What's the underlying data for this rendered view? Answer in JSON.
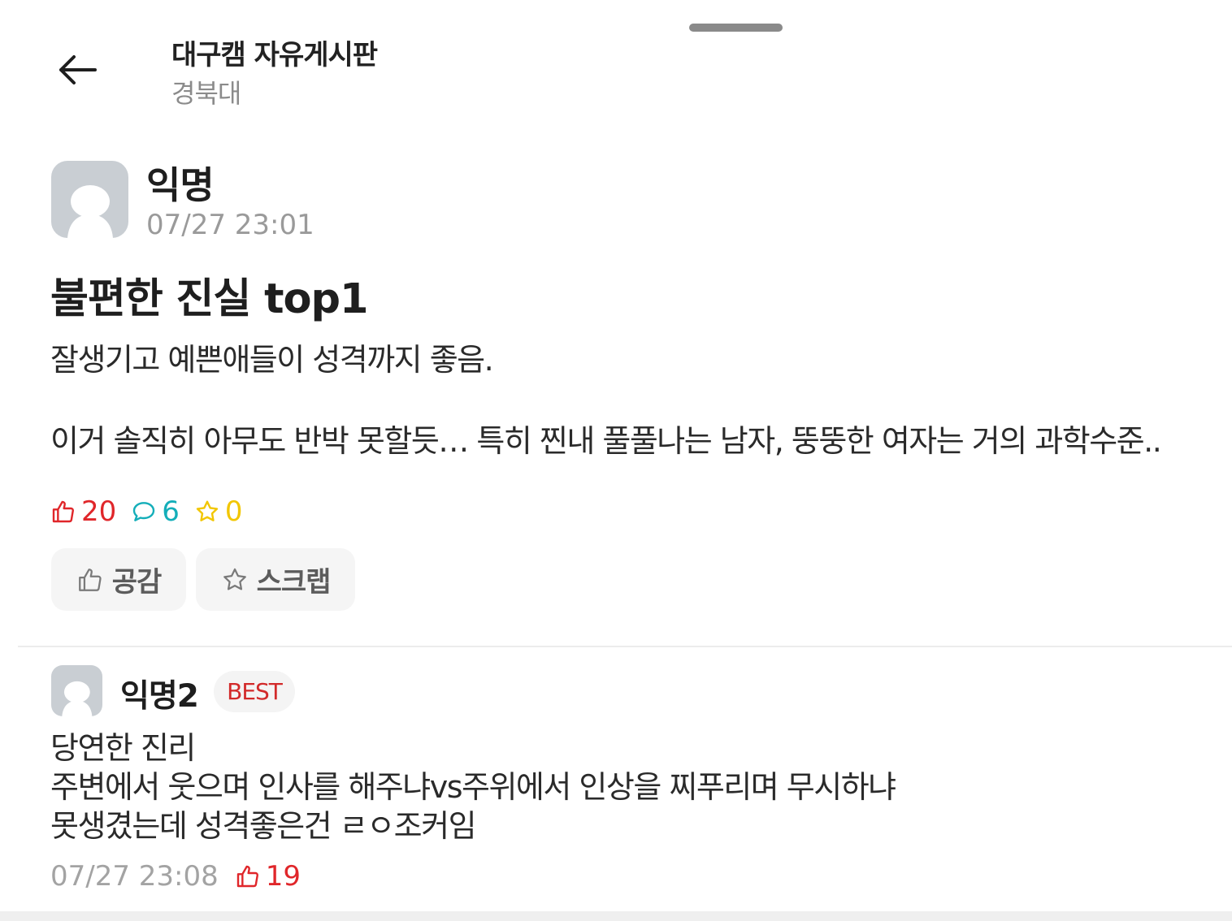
{
  "header": {
    "back_icon": "arrow-left-icon",
    "board_title": "대구캠 자유게시판",
    "board_subtitle": "경북대"
  },
  "post": {
    "author": "익명",
    "timestamp": "07/27 23:01",
    "title": "불편한 진실 top1",
    "body_lines": [
      "잘생기고 예쁜애들이 성격까지 좋음.",
      "이거 솔직히 아무도 반박 못할듯… 특히 찐내 풀풀나는 남자, 뚱뚱한 여자는 거의 과학수준.."
    ],
    "stats": {
      "likes": "20",
      "comments": "6",
      "scraps": "0"
    },
    "actions": {
      "like_label": "공감",
      "scrap_label": "스크랩"
    }
  },
  "comment": {
    "author": "익명2",
    "badge": "BEST",
    "body_lines": [
      "당연한 진리",
      "주변에서 웃으며 인사를 해주냐vs주위에서 인상을 찌푸리며 무시하냐",
      "못생겼는데 성격좋은건 ㄹㅇ조커임"
    ],
    "timestamp": "07/27 23:08",
    "likes": "19"
  },
  "colors": {
    "like_red": "#e0262a",
    "comment_teal": "#14aeb9",
    "scrap_yellow": "#f2c600",
    "avatar_gray": "#c9ced3",
    "button_bg": "#f5f5f5"
  }
}
